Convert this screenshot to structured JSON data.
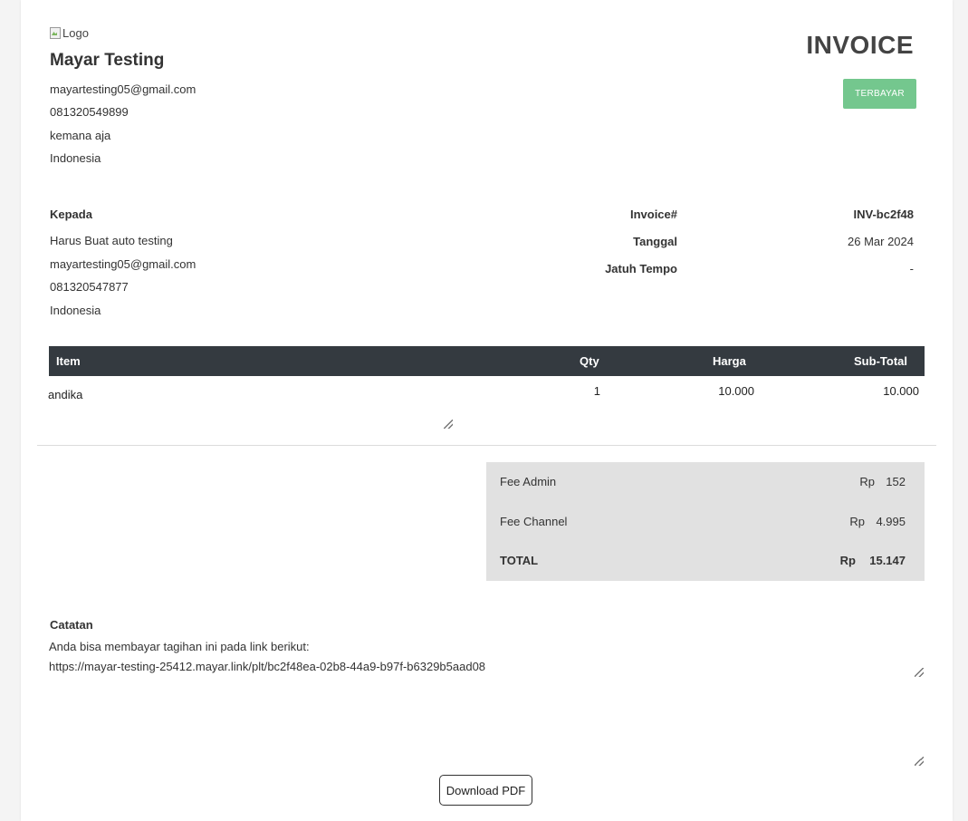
{
  "header": {
    "logo_alt": "Logo",
    "company_name": "Mayar Testing",
    "company_email": "mayartesting05@gmail.com",
    "company_phone": "081320549899",
    "company_address": "kemana aja",
    "company_country": "Indonesia",
    "document_title": "INVOICE",
    "status": "TERBAYAR",
    "status_color": "#74c78e"
  },
  "bill_to": {
    "heading": "Kepada",
    "name": "Harus Buat auto testing",
    "email": "mayartesting05@gmail.com",
    "phone": "081320547877",
    "country": "Indonesia"
  },
  "meta": {
    "invoice_label": "Invoice#",
    "invoice_value": "INV-bc2f48",
    "date_label": "Tanggal",
    "date_value": "26 Mar 2024",
    "due_label": "Jatuh Tempo",
    "due_value": "-"
  },
  "items_table": {
    "headers": {
      "item": "Item",
      "qty": "Qty",
      "price": "Harga",
      "subtotal": "Sub-Total"
    },
    "header_color": "#343a40",
    "rows": [
      {
        "item": "andika",
        "qty": "1",
        "price": "10.000",
        "subtotal": "10.000"
      }
    ]
  },
  "totals": {
    "fee_admin": {
      "label": "Fee Admin",
      "currency": "Rp",
      "amount": "152"
    },
    "fee_channel": {
      "label": "Fee Channel",
      "currency": "Rp",
      "amount": "4.995"
    },
    "total": {
      "label": "TOTAL",
      "currency": "Rp",
      "amount": "15.147"
    }
  },
  "notes": {
    "heading": "Catatan",
    "line1": "Anda bisa membayar tagihan ini pada link berikut:",
    "line2": "https://mayar-testing-25412.mayar.link/plt/bc2f48ea-02b8-44a9-b97f-b6329b5aad08"
  },
  "actions": {
    "download_label": "Download PDF"
  }
}
